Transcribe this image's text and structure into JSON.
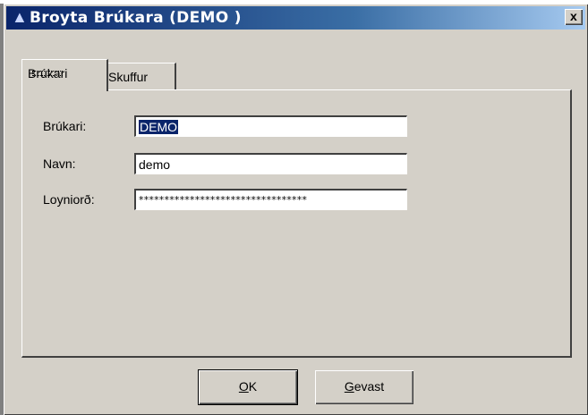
{
  "window": {
    "title": "Broyta Brúkara (DEMO )",
    "close_glyph": "x"
  },
  "tabs": [
    {
      "label": "Brúkari",
      "active": true
    },
    {
      "label": "Skuffur",
      "active": false
    }
  ],
  "form": {
    "user_label": "Brúkari:",
    "user_value": "DEMO",
    "name_label": "Navn:",
    "name_value": "demo",
    "password_label": "Loyniorð:",
    "password_value": "*********************************"
  },
  "buttons": {
    "ok_label_mnemonic": "O",
    "ok_label_rest": "K",
    "cancel_label_mnemonic": "G",
    "cancel_label_rest": "evast"
  },
  "colors": {
    "title_start": "#0a246a",
    "title_end": "#a6caf0",
    "face": "#d4d0c8",
    "selection": "#0a246a"
  },
  "icons": {
    "title_icon": "triangle-app-icon",
    "close_icon": "close-icon"
  }
}
